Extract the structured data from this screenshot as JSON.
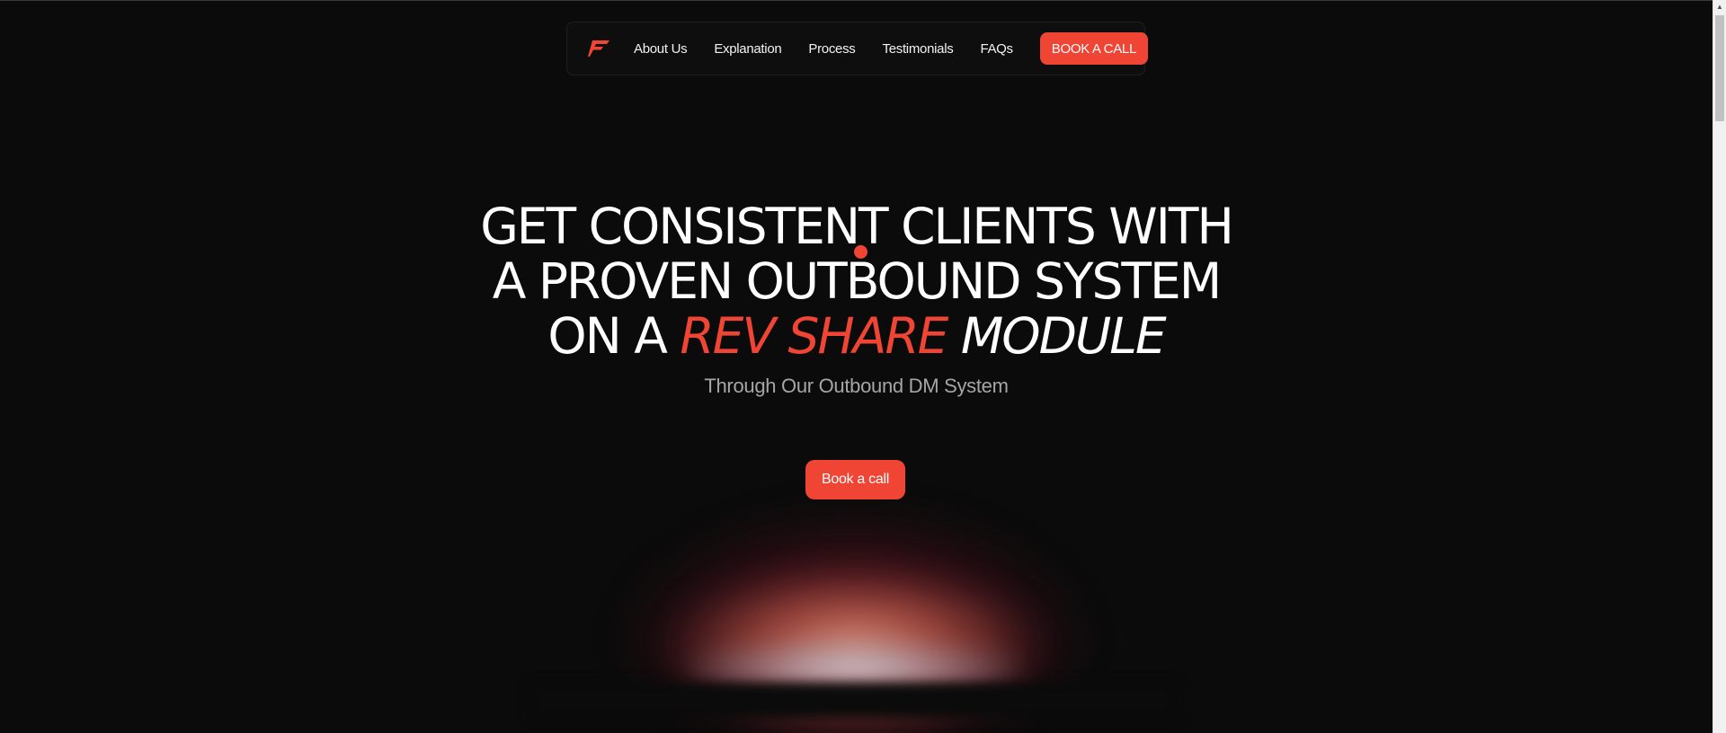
{
  "nav": {
    "logo_icon": "flash-f-logo-icon",
    "links": [
      {
        "label": "About Us"
      },
      {
        "label": "Explanation"
      },
      {
        "label": "Process"
      },
      {
        "label": "Testimonials"
      },
      {
        "label": "FAQs"
      }
    ],
    "cta_label": "BOOK A CALL"
  },
  "hero": {
    "title_line1": "GET CONSISTENT CLIENTS WITH",
    "title_line2": "A PROVEN OUTBOUND SYSTEM",
    "title_line3_prefix": "ON A",
    "title_line3_accent": "REV SHARE",
    "title_line3_suffix": "MODULE",
    "subtitle": "Through Our Outbound DM System",
    "cta_label": "Book a call"
  },
  "colors": {
    "accent": "#f04434",
    "background": "#0b0b0b",
    "subtitle": "#a6a6a6"
  }
}
